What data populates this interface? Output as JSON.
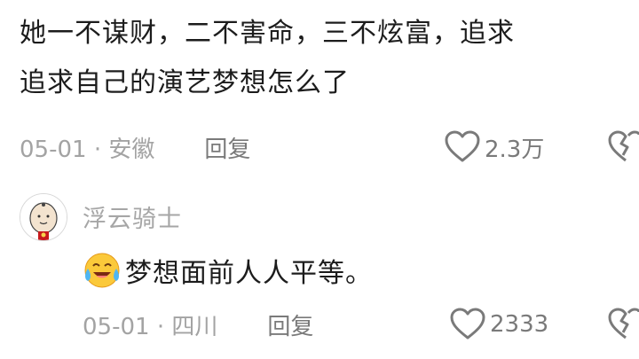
{
  "main_comment": {
    "text_line1": "她一不谋财，二不害命，三不炫富，追求",
    "text_line2": "追求自己的演艺梦想怎么了",
    "date": "05-01 · 安徽",
    "reply_label": "回复",
    "likes": "2.3万"
  },
  "reply": {
    "username": "浮云骑士",
    "text": "梦想面前人人平等。",
    "emoji": "crying-laughing-emoji",
    "date": "05-01 · 四川",
    "reply_label": "回复",
    "likes": "2333"
  },
  "icons": {
    "like": "heart-outline-icon",
    "dislike": "broken-heart-icon"
  },
  "colors": {
    "text": "#1c1c1c",
    "meta": "#a3a3a3",
    "icon": "#7a7a7a"
  }
}
